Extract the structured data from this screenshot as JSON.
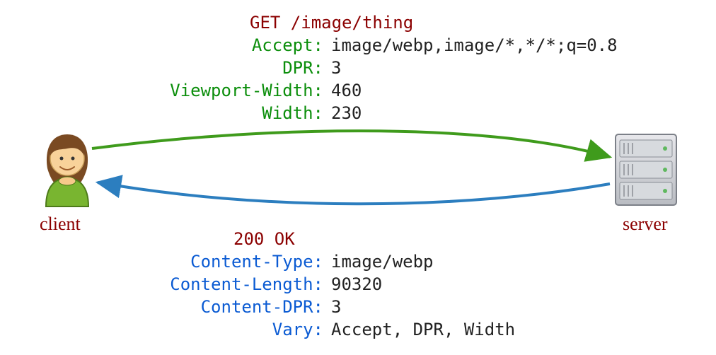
{
  "request": {
    "method_line": "GET /image/thing",
    "headers": [
      {
        "name": "Accept:",
        "value": "image/webp,image/*,*/*;q=0.8"
      },
      {
        "name": "DPR:",
        "value": "3"
      },
      {
        "name": "Viewport-Width:",
        "value": "460"
      },
      {
        "name": "Width:",
        "value": "230"
      }
    ]
  },
  "response": {
    "status_line": "200 OK",
    "headers": [
      {
        "name": "Content-Type:",
        "value": "image/webp"
      },
      {
        "name": "Content-Length:",
        "value": "90320"
      },
      {
        "name": "Content-DPR:",
        "value": "3"
      },
      {
        "name": "Vary:",
        "value": "Accept, DPR, Width"
      }
    ]
  },
  "labels": {
    "client": "client",
    "server": "server"
  },
  "colors": {
    "request_arrow": "#3F9B1C",
    "response_arrow": "#2C7EBF",
    "maroon": "#8B0000",
    "header_green": "#0B8E0B",
    "header_blue": "#0B5BD3"
  }
}
